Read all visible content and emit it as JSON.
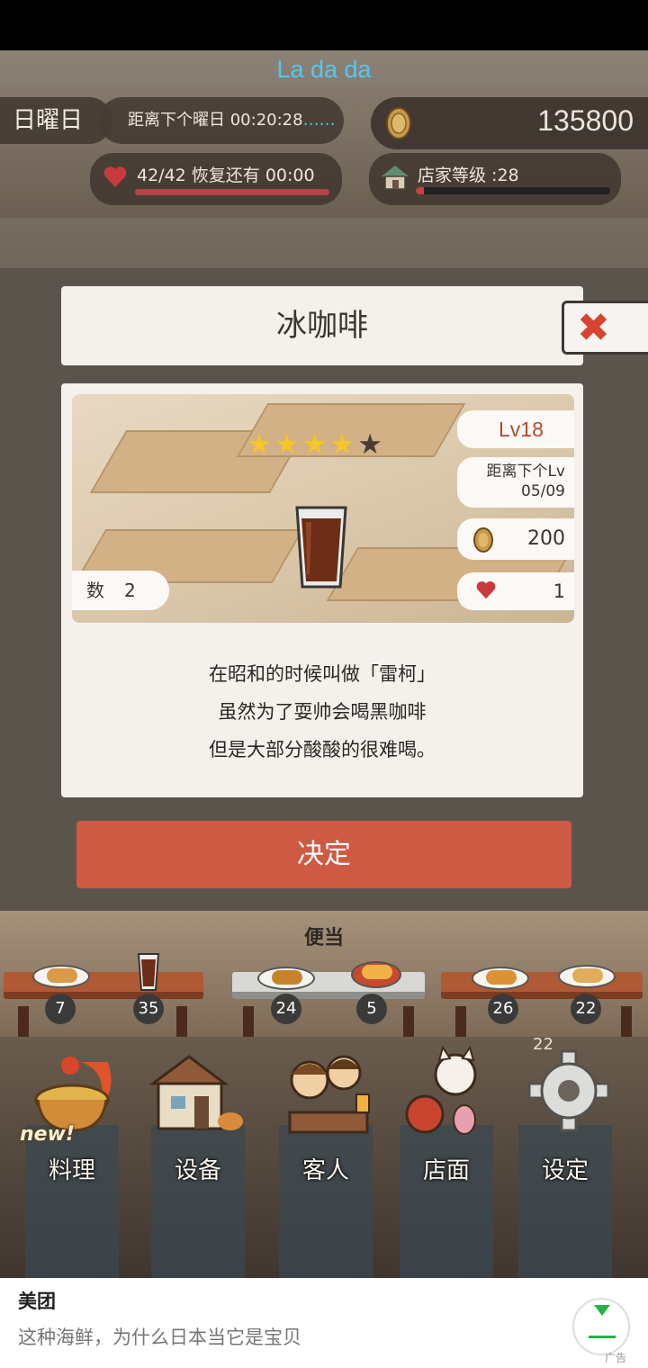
{
  "hud": {
    "player_name": "La da da",
    "weekday": "日曜日",
    "next_day_label": "距离下个曜日 00:20:28",
    "next_day_more": "……",
    "coins": "135800",
    "stamina": "42/42 恢复还有  00:00",
    "shop_level": "店家等级 :28",
    "shop_level_progress": 0.04
  },
  "dialog": {
    "title": "冰咖啡",
    "close_label": "✖",
    "stars_total": 5,
    "stars_filled": 4,
    "level": "Lv18",
    "next_level_label": "距离下个Lv",
    "next_level_progress": "05/09",
    "price": "200",
    "love": "1",
    "count_label": "数",
    "count_value": "2",
    "description": [
      "在昭和的时候叫做「雷柯」",
      "虽然为了耍帅会喝黑咖啡",
      "但是大部分酸酸的很难喝。"
    ],
    "confirm_label": "决定"
  },
  "menu_shelf": {
    "label": "便当",
    "items": [
      {
        "count": "7"
      },
      {
        "count": "35"
      },
      {
        "count": "24"
      },
      {
        "count": "5"
      },
      {
        "count": "26"
      },
      {
        "count": "22"
      }
    ],
    "gear_count": "22"
  },
  "nav": {
    "new_badge": "new!",
    "items": [
      {
        "label": "料理"
      },
      {
        "label": "设备"
      },
      {
        "label": "客人"
      },
      {
        "label": "店面"
      },
      {
        "label": "设定"
      }
    ]
  },
  "ad": {
    "brand": "美团",
    "text": "这种海鲜，为什么日本当它是宝贝",
    "tag": "广告"
  },
  "colors": {
    "confirm": "#cf5a43",
    "player_name": "#54c6f0",
    "level": "#b24c2b",
    "star_on": "#f5c52a"
  }
}
